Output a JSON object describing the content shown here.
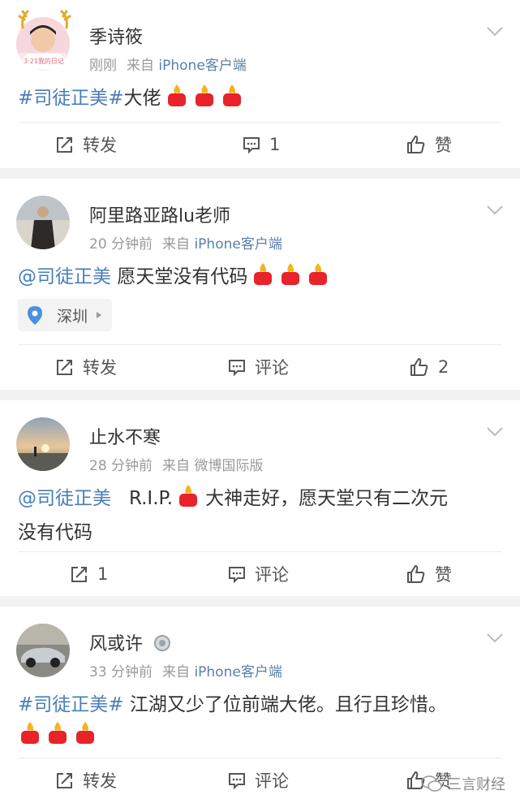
{
  "posts": [
    {
      "username": "季诗筱",
      "time": "刚刚",
      "source_prefix": "来自",
      "source_name": "iPhone客户端",
      "avatar_badge": "3·21我的日记",
      "content_tag": "#司徒正美#",
      "content_text": "大佬",
      "flame_count": 3,
      "actions": {
        "repost": "转发",
        "comment": "1",
        "like": "赞"
      }
    },
    {
      "username": "阿里路亚路lu老师",
      "time": "20 分钟前",
      "source_prefix": "来自",
      "source_name": "iPhone客户端",
      "content_mention": "@司徒正美",
      "content_text": "愿天堂没有代码",
      "flame_count": 3,
      "location": "深圳",
      "actions": {
        "repost": "转发",
        "comment": "评论",
        "like": "2"
      }
    },
    {
      "username": "止水不寒",
      "time": "28 分钟前",
      "source_prefix": "来自",
      "source_name": "微博国际版",
      "content_mention": "@司徒正美",
      "content_text_before": "R.I.P.",
      "content_text_after": "大神走好，愿天堂只有二次元",
      "content_text_line2": "没有代码",
      "actions": {
        "repost": "1",
        "comment": "评论",
        "like": "赞"
      }
    },
    {
      "username": "风或许",
      "time": "33 分钟前",
      "source_prefix": "来自",
      "source_name": "iPhone客户端",
      "content_tag": "#司徒正美#",
      "content_text": "江湖又少了位前端大佬。且行且珍惜。",
      "flame_count": 3,
      "actions": {
        "repost": "转发",
        "comment": "评论",
        "like": "赞"
      }
    }
  ],
  "watermark": "三言财经",
  "colors": {
    "link": "#4a7db8",
    "meta": "#9a9a9a",
    "background": "#f2f2f2"
  }
}
